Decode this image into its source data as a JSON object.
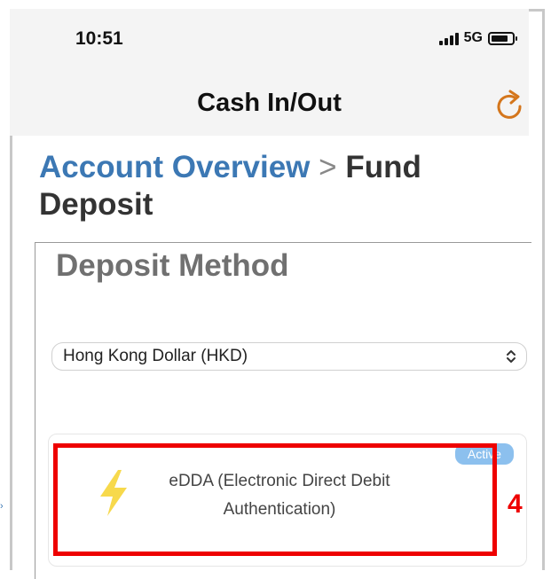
{
  "status_bar": {
    "time": "10:51",
    "network": "5G",
    "icons": [
      "signal-bars-icon",
      "battery-icon"
    ]
  },
  "nav": {
    "title": "Cash In/Out",
    "refresh_icon": "refresh-icon",
    "accent_color": "#d4761c"
  },
  "breadcrumb": {
    "link": "Account Overview",
    "separator": ">",
    "current": "Fund Deposit",
    "link_color": "#3c78b4"
  },
  "deposit": {
    "section_title": "Deposit Method",
    "currency_selected": "Hong Kong Dollar (HKD)",
    "methods": [
      {
        "label": "eDDA (Electronic Direct Debit Authentication)",
        "badge": "Active",
        "icon": "lightning-icon",
        "icon_color": "#f7d94c"
      }
    ]
  },
  "annotation": {
    "number": "4",
    "color": "#ee0000"
  }
}
